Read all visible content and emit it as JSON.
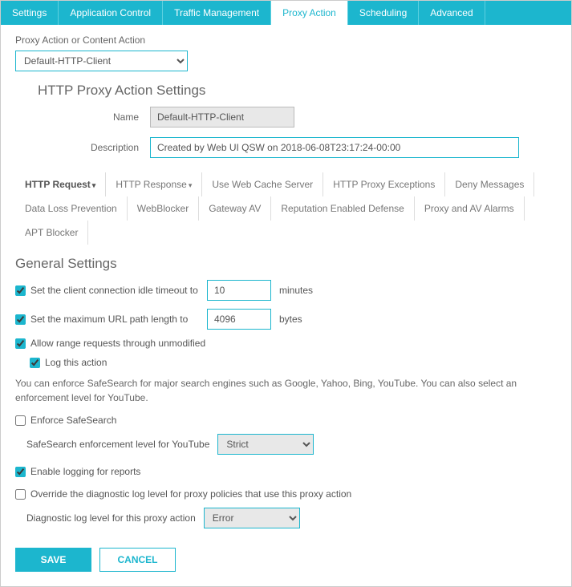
{
  "tabs": {
    "settings": "Settings",
    "app_control": "Application Control",
    "traffic": "Traffic Management",
    "proxy_action": "Proxy Action",
    "scheduling": "Scheduling",
    "advanced": "Advanced"
  },
  "proxy_action_label": "Proxy Action or Content Action",
  "proxy_action_value": "Default-HTTP-Client",
  "section_title": "HTTP Proxy Action Settings",
  "form": {
    "name_label": "Name",
    "name_value": "Default-HTTP-Client",
    "desc_label": "Description",
    "desc_value": "Created by Web UI QSW on 2018-06-08T23:17:24-00:00"
  },
  "subtabs": {
    "http_request": "HTTP Request",
    "http_response": "HTTP Response",
    "use_web_cache": "Use Web Cache Server",
    "http_proxy_exc": "HTTP Proxy Exceptions",
    "deny_messages": "Deny Messages",
    "dlp": "Data Loss Prevention",
    "webblocker": "WebBlocker",
    "gateway_av": "Gateway AV",
    "red": "Reputation Enabled Defense",
    "proxy_av_alarms": "Proxy and AV Alarms",
    "apt_blocker": "APT Blocker"
  },
  "general": {
    "title": "General Settings",
    "idle_timeout_label": "Set the client connection idle timeout to",
    "idle_timeout_value": "10",
    "idle_timeout_unit": "minutes",
    "url_length_label": "Set the maximum URL path length to",
    "url_length_value": "4096",
    "url_length_unit": "bytes",
    "allow_range": "Allow range requests through unmodified",
    "log_action": "Log this action",
    "safesearch_help": "You can enforce SafeSearch for major search engines such as Google, Yahoo, Bing, YouTube. You can also select an enforcement level for YouTube.",
    "enforce_safesearch": "Enforce SafeSearch",
    "safesearch_level_label": "SafeSearch enforcement level for YouTube",
    "safesearch_level_value": "Strict",
    "enable_logging": "Enable logging for reports",
    "override_diag": "Override the diagnostic log level for proxy policies that use this proxy action",
    "diag_level_label": "Diagnostic log level for this proxy action",
    "diag_level_value": "Error"
  },
  "buttons": {
    "save": "SAVE",
    "cancel": "CANCEL"
  }
}
